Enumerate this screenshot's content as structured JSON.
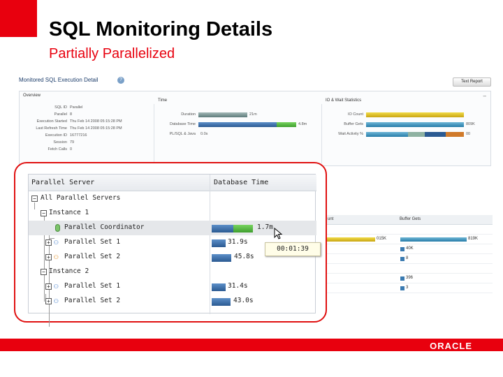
{
  "slide": {
    "title": "SQL Monitoring Details",
    "subtitle": "Partially Parallelized",
    "brand": "ORACLE",
    "accent_color": "#e8000e"
  },
  "screenshot": {
    "title": "Monitored SQL Execution Detail",
    "button": "Text Report",
    "overview": {
      "label": "Overview",
      "fields": [
        {
          "key": "SQL ID",
          "value": "Parallel"
        },
        {
          "key": "Parallel",
          "value": "8"
        },
        {
          "key": "Execution Started",
          "value": "Thu Feb 14 2008 05:15:28 PM"
        },
        {
          "key": "Last Refresh Time",
          "value": "Thu Feb 14 2008 05:15:28 PM"
        },
        {
          "key": "Execution ID",
          "value": "16777216"
        },
        {
          "key": "Session",
          "value": "79"
        },
        {
          "key": "Fetch Calls",
          "value": "0"
        }
      ],
      "time": {
        "heading": "Time",
        "rows": [
          {
            "key": "Duration",
            "value": "21m"
          },
          {
            "key": "Database Time",
            "value": "4.8m"
          },
          {
            "key": "PL/SQL & Java",
            "value": "0.0s"
          }
        ]
      },
      "io": {
        "heading": "IO & Wait Statistics",
        "rows": [
          {
            "key": "IO Count",
            "value": ""
          },
          {
            "key": "Buffer Gets",
            "value": "809K"
          },
          {
            "key": "Wait Activity %",
            "value": "00"
          }
        ]
      }
    },
    "right_table": {
      "headers": [
        "unt",
        "Buffer Gets"
      ],
      "rows": [
        {
          "a": "",
          "b": ""
        },
        {
          "a": "015K",
          "b": "819K"
        },
        {
          "a": "",
          "b": "40K"
        },
        {
          "a": "",
          "b": "8"
        },
        {
          "a": "",
          "b": ""
        },
        {
          "a": "",
          "b": "396"
        },
        {
          "a": "",
          "b": "3"
        }
      ]
    },
    "zoom": {
      "headers": {
        "server": "Parallel Server",
        "time": "Database Time"
      },
      "rows": [
        {
          "label": "All Parallel Servers",
          "value": ""
        },
        {
          "label": "Instance 1",
          "value": ""
        },
        {
          "label": "Parallel Coordinator",
          "value": "1.7m"
        },
        {
          "label": "Parallel Set 1",
          "value": "31.9s"
        },
        {
          "label": "Parallel Set 2",
          "value": "45.8s"
        },
        {
          "label": "Instance 2",
          "value": ""
        },
        {
          "label": "Parallel Set 1",
          "value": "31.4s"
        },
        {
          "label": "Parallel Set 2",
          "value": "43.0s"
        }
      ],
      "tooltip": "00:01:39"
    }
  }
}
